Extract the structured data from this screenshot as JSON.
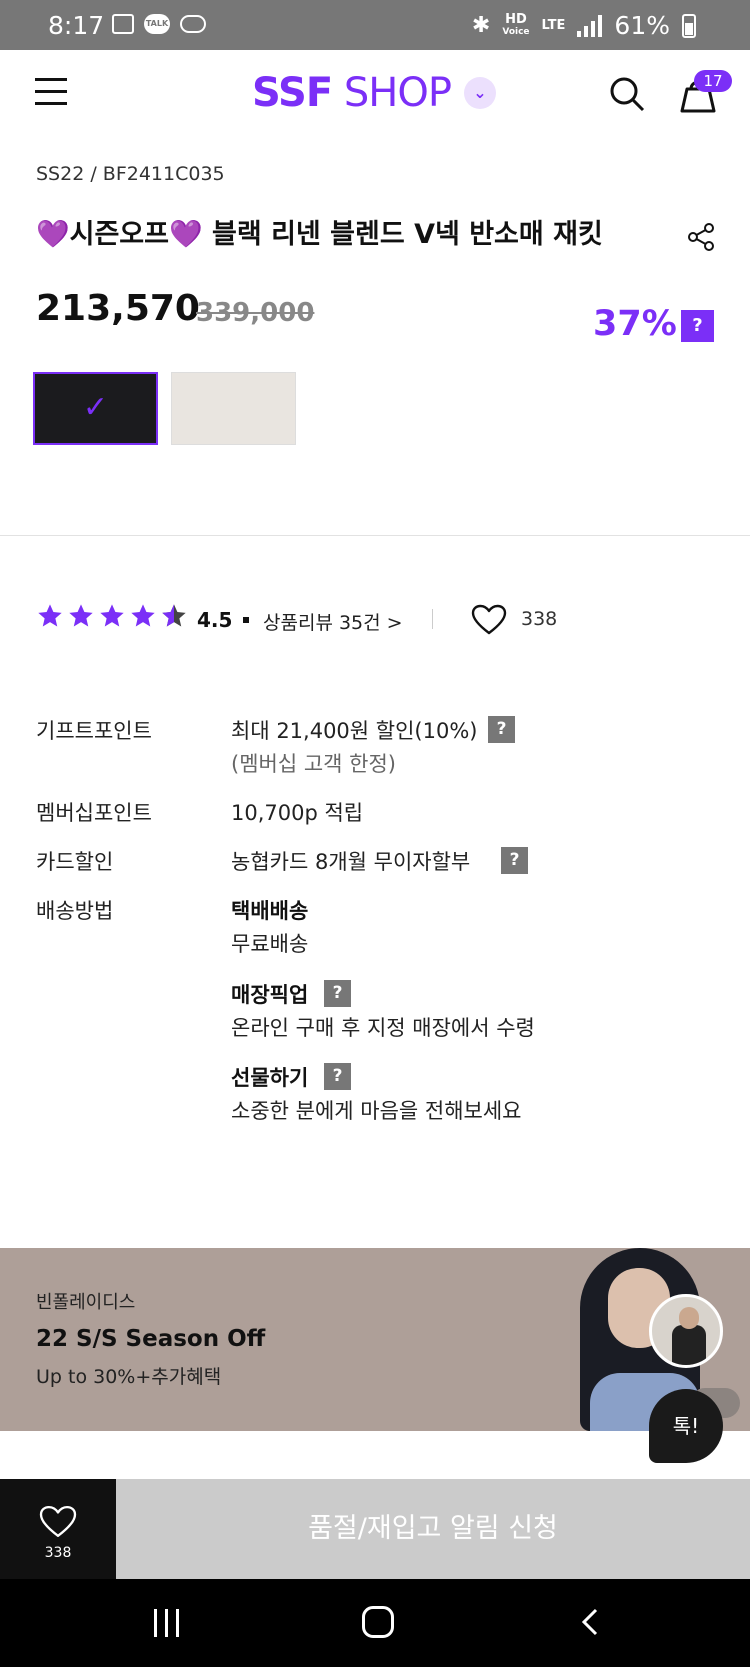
{
  "status_bar": {
    "time": "8:17",
    "talk_label": "TALK",
    "network_top": "HD",
    "network_bottom": "Voice",
    "lte": "LTE",
    "battery": "61%"
  },
  "header": {
    "logo_bold": "SSF",
    "logo_light": " SHOP",
    "cart_count": "17"
  },
  "product": {
    "code": "SS22 / BF2411C035",
    "title": "💜시즌오프💜 블랙 리넨 블렌드 V넥 반소매 재킷",
    "price": "213,570",
    "original_price": "339,000",
    "discount": "37%",
    "help_mark": "?",
    "selected_color_check": "✓",
    "colors": [
      "black",
      "beige"
    ]
  },
  "rating": {
    "score": "4.5",
    "stars": 4.5,
    "review_link": "상품리뷰 35건 >",
    "likes": "338"
  },
  "info": {
    "gift_point_label": "기프트포인트",
    "gift_point_value": "최대 21,400원 할인(10%)",
    "gift_point_note": "(멤버십 고객 한정)",
    "membership_label": "멤버십포인트",
    "membership_value": "10,700p 적립",
    "card_label": "카드할인",
    "card_value": "농협카드 8개월 무이자할부",
    "delivery_label": "배송방법",
    "delivery_title": "택배배송",
    "delivery_desc": "무료배송",
    "pickup_title": "매장픽업",
    "pickup_desc": "온라인 구매 후 지정 매장에서 수령",
    "gift_title": "선물하기",
    "gift_desc": "소중한 분에게 마음을 전해보세요"
  },
  "banner": {
    "brand": "빈폴레이디스",
    "headline": "22 S/S Season Off",
    "sub": "Up to 30%+추가혜택"
  },
  "talk_button": "톡!",
  "bottom_bar": {
    "wish_count": "338",
    "restock_label": "품절/재입고 알림 신청"
  },
  "colors": {
    "accent": "#7b2ff7",
    "banner_bg": "#ae9f98",
    "disabled_button": "#cbcbcb"
  }
}
